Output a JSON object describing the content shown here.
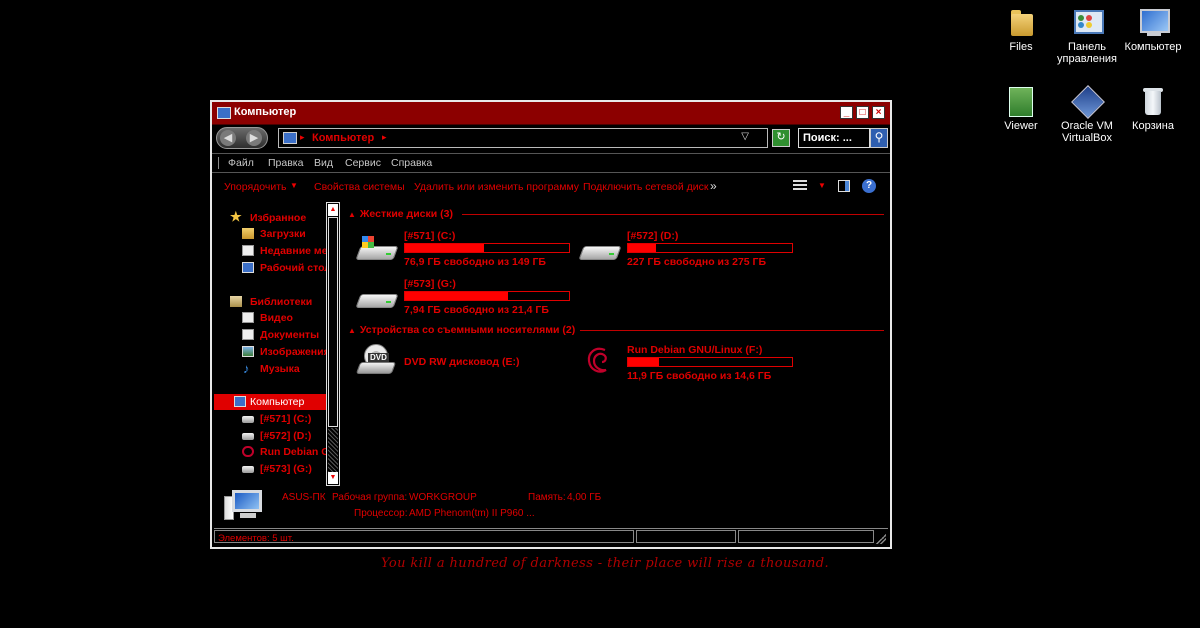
{
  "desktop": {
    "icons": [
      {
        "label": "Files",
        "icon": "folder-icon"
      },
      {
        "label": "Панель управления",
        "icon": "control-panel-icon"
      },
      {
        "label": "Компьютер",
        "icon": "computer-icon"
      },
      {
        "label": "Viewer",
        "icon": "viewer-icon"
      },
      {
        "label": "Oracle VM VirtualBox",
        "icon": "virtualbox-icon"
      },
      {
        "label": "Корзина",
        "icon": "recycle-bin-icon"
      }
    ],
    "wallpaper_quote": "You kill a hundred of darkness - their place will rise a thousand."
  },
  "window": {
    "title": "Компьютер",
    "controls": {
      "minimize": "_",
      "maximize": "□",
      "close": "×"
    },
    "address": {
      "crumb": "Компьютер"
    },
    "search_placeholder": "Поиск: ...",
    "menu": [
      "Файл",
      "Правка",
      "Вид",
      "Сервис",
      "Справка"
    ],
    "commands": [
      "Упорядочить",
      "Свойства системы",
      "Удалить или изменить программу",
      "Подключить сетевой диск"
    ],
    "more": "»"
  },
  "nav_pane": {
    "favorites": {
      "label": "Избранное",
      "items": [
        "Загрузки",
        "Недавние места",
        "Рабочий стол"
      ]
    },
    "libraries": {
      "label": "Библиотеки",
      "items": [
        "Видео",
        "Документы",
        "Изображения",
        "Музыка"
      ]
    },
    "computer": {
      "label": "Компьютер",
      "items": [
        "[#571] (C:)",
        "[#572] (D:)",
        "Run Debian GNU/Linux (F:)",
        "[#573] (G:)"
      ]
    }
  },
  "groups": {
    "hard_disks": {
      "header": "Жесткие диски (3)"
    },
    "removable": {
      "header": "Устройства со съемными носителями (2)"
    }
  },
  "drives": [
    {
      "name": "[#571] (C:)",
      "free_text": "76,9 ГБ свободно из 149 ГБ",
      "used_fraction": 0.48
    },
    {
      "name": "[#572] (D:)",
      "free_text": "227 ГБ свободно из 275 ГБ",
      "used_fraction": 0.17
    },
    {
      "name": "[#573] (G:)",
      "free_text": "7,94 ГБ свободно из 21,4 ГБ",
      "used_fraction": 0.63
    },
    {
      "name": "DVD RW дисковод (E:)",
      "free_text": "",
      "used_fraction": null
    },
    {
      "name": "Run Debian GNU/Linux (F:)",
      "free_text": "11,9 ГБ свободно из 14,6 ГБ",
      "used_fraction": 0.19
    }
  ],
  "details": {
    "computer_name": "ASUS-ПК",
    "workgroup_label": "Рабочая группа:",
    "workgroup": "WORKGROUP",
    "memory_label": "Память:",
    "memory": "4,00 ГБ",
    "processor_label": "Процессор:",
    "processor": "AMD Phenom(tm) II P960 ..."
  },
  "status": {
    "items_text": "Элементов: 5 шт."
  },
  "colors": {
    "accent": "#e00000",
    "title_bar": "#8c0000",
    "background": "#000000"
  }
}
